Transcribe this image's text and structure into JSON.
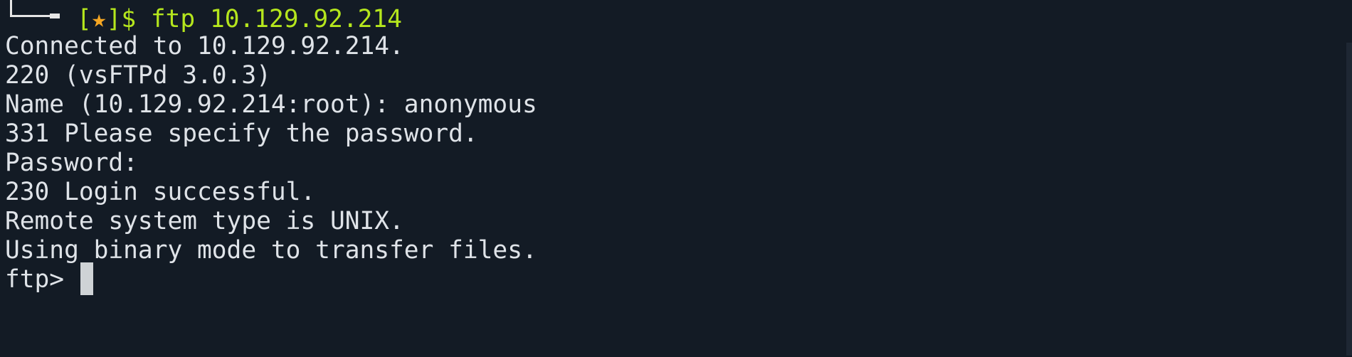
{
  "terminal": {
    "prompt": {
      "bracket_open": "[",
      "star": "★",
      "bracket_close": "]$ ",
      "command": "ftp 10.129.92.214"
    },
    "output_lines": [
      "Connected to 10.129.92.214.",
      "220 (vsFTPd 3.0.3)",
      "Name (10.129.92.214:root): anonymous",
      "331 Please specify the password.",
      "Password:",
      "230 Login successful.",
      "Remote system type is UNIX.",
      "Using binary mode to transfer files."
    ],
    "ftp_prompt": "ftp> "
  },
  "colors": {
    "background": "#131b25",
    "text": "#dfe3e8",
    "prompt_green": "#b5e61d",
    "star_orange": "#f5a623"
  }
}
